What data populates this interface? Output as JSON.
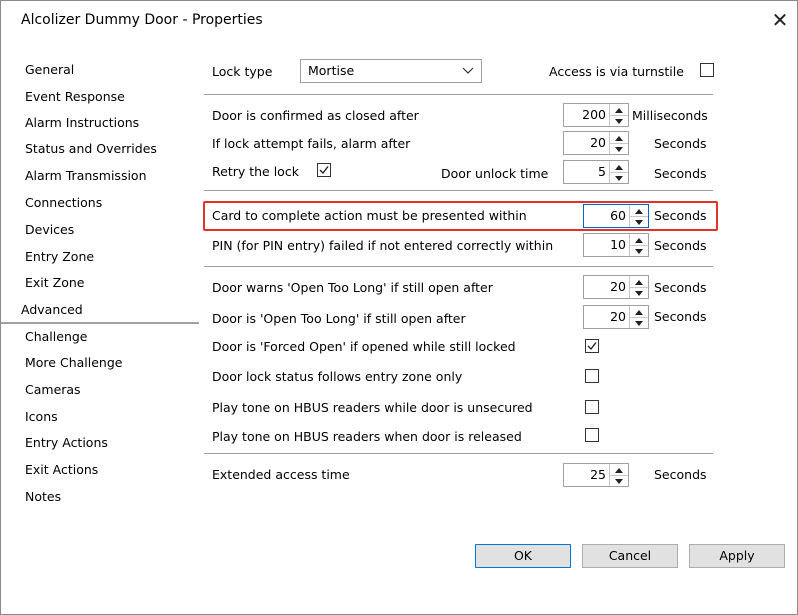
{
  "window": {
    "title": "Alcolizer Dummy Door - Properties",
    "close_glyph": "✕"
  },
  "nav": [
    "General",
    "Event Response",
    "Alarm Instructions",
    "Status and Overrides",
    "Alarm Transmission",
    "Connections",
    "Devices",
    "Entry Zone",
    "Exit Zone",
    "Advanced",
    "Challenge",
    "More Challenge",
    "Cameras",
    "Icons",
    "Entry Actions",
    "Exit Actions",
    "Notes"
  ],
  "selected_nav": "Advanced",
  "lock": {
    "label": "Lock type",
    "value": "Mortise",
    "turnstile_label": "Access is via turnstile",
    "turnstile_checked": false
  },
  "timing": {
    "closed_label": "Door is confirmed as closed after",
    "closed_value": "200",
    "closed_unit": "Milliseconds",
    "fail_label": "If lock attempt fails, alarm after",
    "fail_value": "20",
    "fail_unit": "Seconds",
    "retry_label": "Retry the lock",
    "retry_checked": true,
    "unlock_label": "Door unlock time",
    "unlock_value": "5",
    "unlock_unit": "Seconds"
  },
  "card": {
    "card_label": "Card to complete action must be presented within",
    "card_value": "60",
    "card_unit": "Seconds",
    "pin_label": "PIN (for PIN entry) failed if not entered correctly within",
    "pin_value": "10",
    "pin_unit": "Seconds"
  },
  "open": {
    "warn_label": "Door warns 'Open Too Long' if still open after",
    "warn_value": "20",
    "warn_unit": "Seconds",
    "otl_label": "Door is 'Open Too Long' if still open after",
    "otl_value": "20",
    "otl_unit": "Seconds",
    "forced_label": "Door is 'Forced Open' if opened while still locked",
    "forced_checked": true,
    "follows_label": "Door lock status follows entry zone only",
    "follows_checked": false,
    "tone_unsecured_label": "Play tone on HBUS readers while door is unsecured",
    "tone_unsecured_checked": false,
    "tone_released_label": "Play tone on HBUS readers when door is released",
    "tone_released_checked": false
  },
  "extended": {
    "label": "Extended access time",
    "value": "25",
    "unit": "Seconds"
  },
  "buttons": {
    "ok": "OK",
    "cancel": "Cancel",
    "apply": "Apply"
  },
  "colors": {
    "highlight_box": "#e0332e",
    "focus_border": "#0a64c8",
    "default_button_border": "#0078d7"
  },
  "icons": {
    "close": "close-icon",
    "dropdown": "chevron-down-icon",
    "spin_up": "spin-up-icon",
    "spin_down": "spin-down-icon",
    "check": "checkmark-icon"
  }
}
